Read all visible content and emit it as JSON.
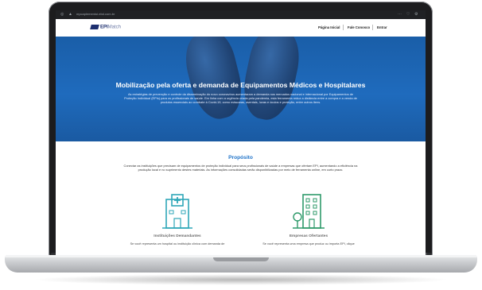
{
  "browser": {
    "url": "mpcaplementoi.ebd.com.br",
    "menu_icon": "ellipsis-icon"
  },
  "site": {
    "logo_text": "EPI",
    "logo_text_2": "Match",
    "nav": [
      "Página Inicial",
      "Fale Conosco",
      "Entrar"
    ]
  },
  "hero": {
    "title": "Mobilização pela oferta e demanda de Equipamentos Médicos e Hospitalares",
    "text": "As estratégias de prevenção e controle da disseminação do novo coronavírus aumentaram a demanda nos mercados nacional e internacional por Equipamentos de Proteção Individual (EPIs) para os profissionais de saúde. Em linha com a urgência criada pela pandemia, esta ferramenta reduz a distância entre a compra e a venda de produtos essenciais ao combate à Covid-19, como máscaras, aventais, luvas e óculos e proteção, entre outros itens."
  },
  "proposito": {
    "title": "Propósito",
    "text": "Conectar as instituições que precisam de equipamentos de proteção individual para seus profissionais de saúde a empresas que ofertam EPI, aumentando a eficiência na produção local e no suprimento destes materiais. As informações consolidadas serão disponibilizadas por meio de ferramenta online, em curto prazo."
  },
  "cards": [
    {
      "title": "Instituições Demandantes",
      "text": "Se você representa um hospital ou instituição clínica com demanda de",
      "icon": "hospital-icon"
    },
    {
      "title": "Empresas Ofertantes",
      "text": "Se você representa uma empresa que produz ou importa EPI, clique",
      "icon": "building-icon"
    }
  ],
  "colors": {
    "hero_blue": "#1f6bbd",
    "accent": "#1f73c9",
    "icon_teal": "#2fa7b8",
    "icon_green": "#2e9a6a"
  }
}
